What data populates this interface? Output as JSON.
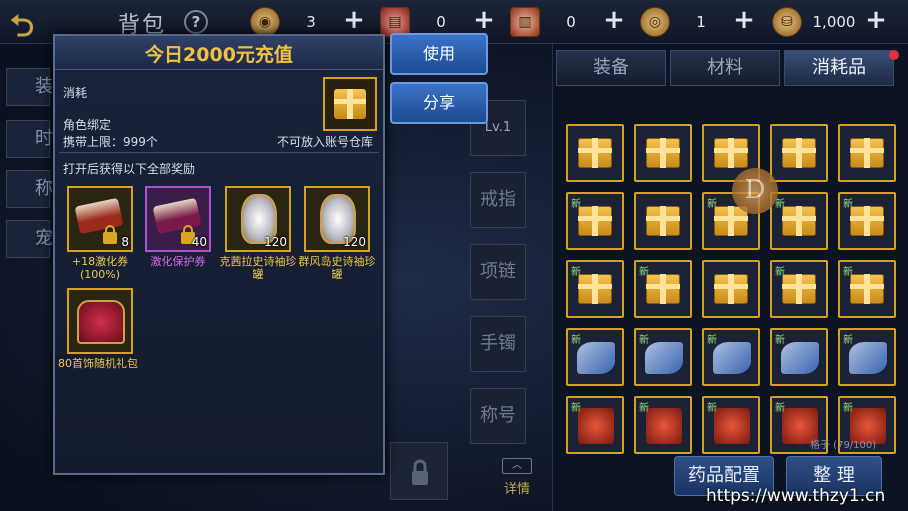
{
  "topbar": {
    "title": "背包",
    "help": "?",
    "currencies": [
      {
        "icon": "gold-coin-icon",
        "value": "3"
      },
      {
        "icon": "red-ticket-icon",
        "value": "0"
      },
      {
        "icon": "red-scroll-icon",
        "value": "0"
      },
      {
        "icon": "bronze-coin-icon",
        "value": "1"
      },
      {
        "icon": "gold-pile-icon",
        "value": "1,000"
      }
    ],
    "plus": "+"
  },
  "popup": {
    "title": "今日2000元充值",
    "type_label": "消耗",
    "bind_label": "角色绑定",
    "limit_label": "携带上限：999个",
    "warehouse_note": "不可放入账号仓库",
    "rewards_heading": "打开后获得以下全部奖励",
    "rewards": [
      {
        "qty": "8",
        "label": "+18激化券(100%)"
      },
      {
        "qty": "40",
        "label": "激化保护券"
      },
      {
        "qty": "120",
        "label": "克茜拉史诗袖珍罐"
      },
      {
        "qty": "120",
        "label": "群风岛史诗袖珍罐"
      },
      {
        "qty": "",
        "label": "80首饰随机礼包"
      }
    ]
  },
  "actions": {
    "use": "使用",
    "share": "分享"
  },
  "bag": {
    "tabs": [
      "装备",
      "材料",
      "消耗品"
    ],
    "new_tag": "新",
    "slot_count": "格子 (79/100)",
    "potion_config": "药品配置",
    "sort": "整 理"
  },
  "equip_slots": [
    "戒指",
    "项链",
    "手镯",
    "称号"
  ],
  "equip_top": "Lv.1",
  "details": "详情",
  "left_tabs": [
    "装",
    "时",
    "称",
    "宠"
  ],
  "badge": "D",
  "watermark": "https://www.thzy1.cn"
}
